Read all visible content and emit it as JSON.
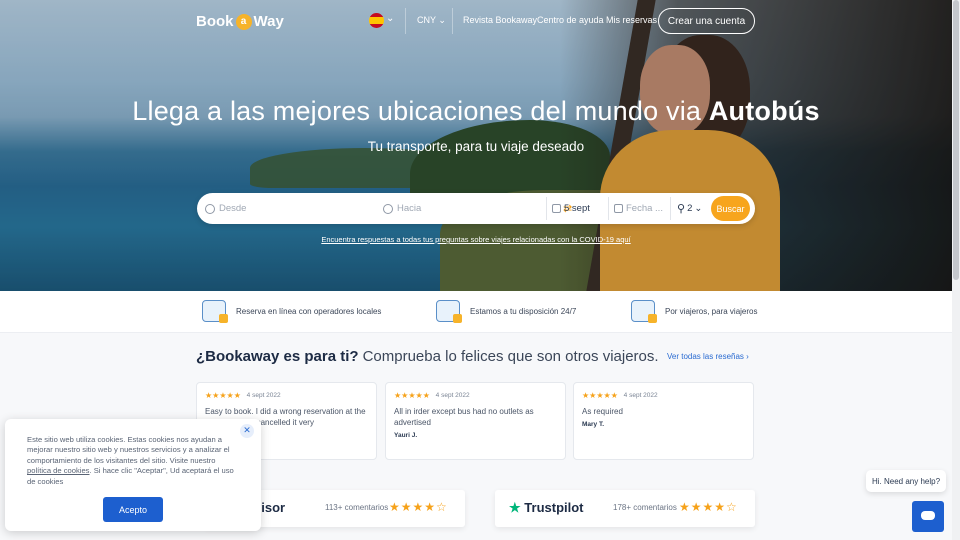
{
  "nav": {
    "logo_pre": "Book",
    "logo_a": "a",
    "logo_post": "Way",
    "currency": "CNY",
    "links": [
      "Revista Bookaway",
      "Centro de ayuda",
      "Mis reservas"
    ],
    "cta": "Crear una cuenta"
  },
  "hero": {
    "title_main": "Llega a las mejores ubicaciones del mundo via ",
    "title_bold": "Autobús",
    "subtitle": "Tu transporte, para tu viaje deseado",
    "covid_link": "Encuentra respuestas a todas tus preguntas sobre viajes relacionadas con la COVID-19 aquí"
  },
  "search": {
    "from_placeholder": "Desde",
    "to_placeholder": "Hacia",
    "date": "5 sept",
    "return_placeholder": "Fecha ...",
    "passengers": "2",
    "button": "Buscar"
  },
  "features": [
    "Reserva en línea con operadores locales",
    "Estamos a tu disposición 24/7",
    "Por viajeros, para viajeros"
  ],
  "reviews_section": {
    "title_bold": "¿Bookaway es para ti?",
    "title_rest": "Comprueba lo felices que son otros viajeros.",
    "see_all": "Ver todas las reseñas",
    "cards": [
      {
        "date": "4 sept 2022",
        "rating": 5,
        "text": "Easy to book. I did a wrong reservation at the ... was able to cancelled it very",
        "author": ""
      },
      {
        "date": "4 sept 2022",
        "rating": 5,
        "text": "All in irder except bus had no outlets as advertised",
        "author": "Yauri J."
      },
      {
        "date": "4 sept 2022",
        "rating": 5,
        "text": "As required",
        "author": "Mary T."
      }
    ]
  },
  "ratings": [
    {
      "brand": "Tripadvisor",
      "count": "113+ comentarios",
      "stars": 4
    },
    {
      "brand": "Trustpilot",
      "count": "178+ comentarios",
      "stars": 4
    }
  ],
  "cookie": {
    "text": "Este sitio web utiliza cookies. Estas cookies nos ayudan a mejorar nuestro sitio web y nuestros servicios y a analizar el comportamiento de los visitantes del sitio. Visite nuestro",
    "link": "política de cookies",
    "text2": ". Si hace clic \"Aceptar\", Ud aceptará el uso de cookies",
    "button": "Acepto"
  },
  "chat": {
    "bubble": "Hi. Need any help?"
  },
  "colors": {
    "accent": "#f7a51d",
    "primary_blue": "#1d5fcf",
    "star": "#f6a21a"
  }
}
